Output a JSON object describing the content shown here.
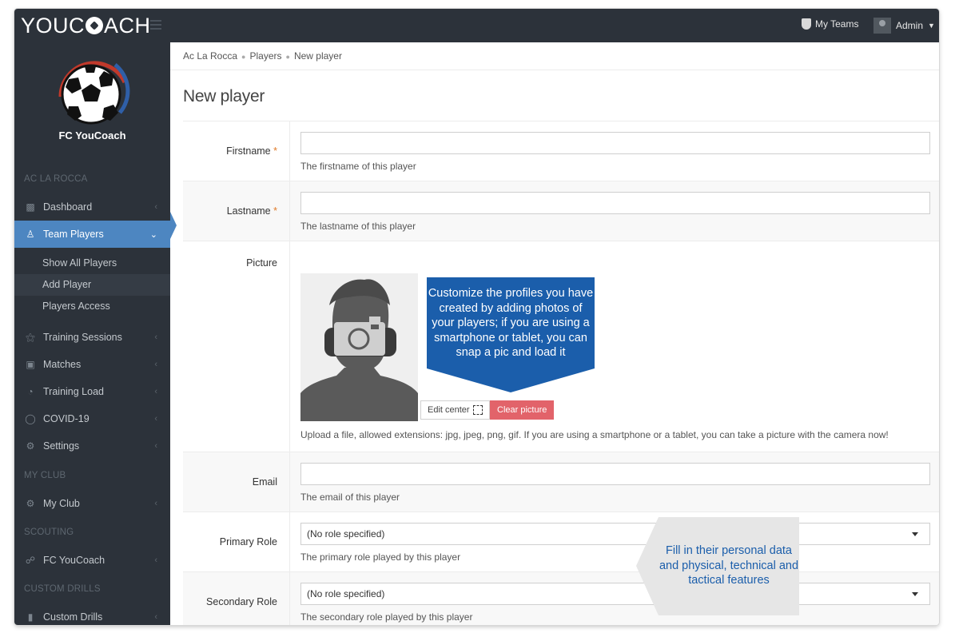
{
  "topbar": {
    "logo": "YOUC",
    "logo_rest": "ACH",
    "my_teams": "My Teams",
    "admin": "Admin"
  },
  "sidebar": {
    "club_name": "FC YouCoach",
    "section_team": "AC LA ROCCA",
    "items": [
      {
        "label": "Dashboard",
        "icon": "bar-chart-icon"
      },
      {
        "label": "Team Players",
        "icon": "players-icon"
      },
      {
        "label": "Training Sessions",
        "icon": "training-icon"
      },
      {
        "label": "Matches",
        "icon": "matches-icon"
      },
      {
        "label": "Training Load",
        "icon": "gauge-icon"
      },
      {
        "label": "COVID-19",
        "icon": "covid-icon"
      },
      {
        "label": "Settings",
        "icon": "gear-icon"
      }
    ],
    "sub_items": [
      "Show All Players",
      "Add Player",
      "Players Access"
    ],
    "section_myclub": "MY CLUB",
    "myclub_item": "My Club",
    "section_scouting": "SCOUTING",
    "scouting_item": "FC YouCoach",
    "section_drills": "CUSTOM DRILLS",
    "drills_item": "Custom Drills"
  },
  "breadcrumb": [
    "Ac La Rocca",
    "Players",
    "New player"
  ],
  "page_title": "New player",
  "form": {
    "firstname": {
      "label": "Firstname",
      "required": "*",
      "value": "",
      "help": "The firstname of this player"
    },
    "lastname": {
      "label": "Lastname",
      "required": "*",
      "value": "",
      "help": "The lastname of this player"
    },
    "picture": {
      "label": "Picture",
      "edit_center": "Edit center",
      "clear": "Clear picture",
      "help": "Upload a file, allowed extensions: jpg, jpeg, png, gif. If you are using a smartphone or a tablet, you can take a picture with the camera now!"
    },
    "email": {
      "label": "Email",
      "value": "",
      "help": "The email of this player"
    },
    "primary_role": {
      "label": "Primary Role",
      "value": "(No role specified)",
      "help": "The primary role played by this player"
    },
    "secondary_role": {
      "label": "Secondary Role",
      "value": "(No role specified)",
      "help": "The secondary role played by this player"
    }
  },
  "callouts": {
    "photo": "Customize the profiles you have created by adding photos of your players; if you are using a smartphone or tablet, you can snap a pic and load it",
    "data": "Fill in their personal data and physical, technical and tactical features"
  },
  "colors": {
    "sidebar": "#2c323a",
    "active": "#4d86c1",
    "callout_blue": "#1b5eab",
    "clear_button": "#e2636a",
    "required": "#e07b2a"
  }
}
